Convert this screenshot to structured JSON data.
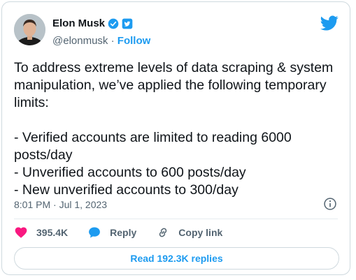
{
  "tweet": {
    "author": {
      "name": "Elon Musk",
      "handle": "@elonmusk",
      "separator": " · ",
      "follow_label": "Follow"
    },
    "text": "To address extreme levels of data scraping & system manipulation, we’ve applied the following temporary limits:\n\n- Verified accounts are limited to reading 6000 posts/day\n- Unverified accounts to 600 posts/day\n- New unverified accounts to 300/day",
    "timestamp": "8:01 PM · Jul 1, 2023",
    "actions": {
      "likes": "395.4K",
      "reply_label": "Reply",
      "copy_link_label": "Copy link"
    },
    "read_replies_label": "Read 192.3K replies"
  },
  "colors": {
    "accent": "#1d9bf0",
    "like": "#f91880",
    "muted": "#536471",
    "text": "#0f1419"
  },
  "icons": [
    "twitter-bird-icon",
    "verified-badge-icon",
    "affiliate-badge-icon",
    "info-icon",
    "heart-icon",
    "reply-bubble-icon",
    "link-icon"
  ]
}
